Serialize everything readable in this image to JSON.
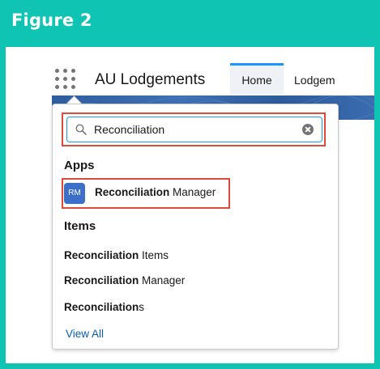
{
  "figure": {
    "title": "Figure 2"
  },
  "header": {
    "app_name": "AU Lodgements",
    "tabs": [
      {
        "label": "Home",
        "active": true
      },
      {
        "label": "Lodgem"
      }
    ]
  },
  "search": {
    "value": "Reconciliation",
    "icon": "search-icon",
    "clear_icon": "clear-icon"
  },
  "apps_section": {
    "heading": "Apps",
    "items": [
      {
        "icon_text": "RM",
        "label_bold": "Reconciliation",
        "label_rest": " Manager"
      }
    ]
  },
  "items_section": {
    "heading": "Items",
    "items": [
      {
        "label_bold": "Reconciliation",
        "label_rest": " Items"
      },
      {
        "label_bold": "Reconciliation",
        "label_rest": " Manager"
      },
      {
        "label_bold": "Reconciliation",
        "label_rest": "s"
      }
    ]
  },
  "view_all_label": "View All",
  "colors": {
    "figure_background": "#0fc4b2",
    "highlight_border": "#e0483a",
    "link": "#0b5cab",
    "app_tile": "#3c6fc9",
    "active_tab_accent": "#1b96ff"
  }
}
